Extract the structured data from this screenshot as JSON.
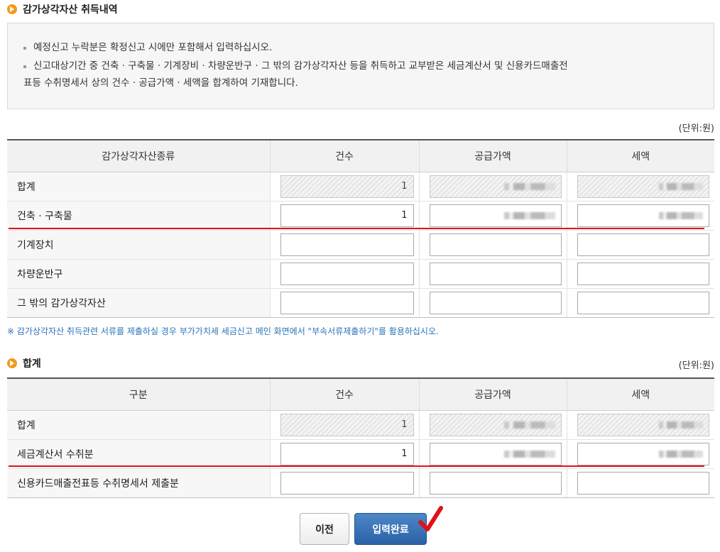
{
  "section1": {
    "title": "감가상각자산 취득내역",
    "notices": [
      "예정신고 누락분은 확정신고 시에만 포함해서 입력하십시오.",
      "신고대상기간 중 건축 · 구축물 · 기계장비 · 차량운반구 · 그 밖의 감가상각자산 등을 취득하고 교부받은 세금계산서 및 신용카드매출전",
      "표등 수취명세서 상의 건수 · 공급가액 · 세액을 합계하여 기재합니다."
    ],
    "unit": "(단위:원)",
    "headers": [
      "감가상각자산종류",
      "건수",
      "공급가액",
      "세액"
    ],
    "rows": [
      {
        "label": "합계",
        "count": "1",
        "readonly": true,
        "masked": true
      },
      {
        "label": "건축 · 구축물",
        "count": "1",
        "readonly": false,
        "masked": true
      },
      {
        "label": "기계장치",
        "count": "",
        "readonly": false,
        "masked": false
      },
      {
        "label": "차량운반구",
        "count": "",
        "readonly": false,
        "masked": false
      },
      {
        "label": "그 밖의 감가상각자산",
        "count": "",
        "readonly": false,
        "masked": false
      }
    ],
    "footnote": "※ 감가상각자산 취득관련 서류를 제출하실 경우 부가가치세 세금신고 메인 화면에서 \"부속서류제출하기\"를 활용하십시오."
  },
  "section2": {
    "title": "합계",
    "unit": "(단위:원)",
    "headers": [
      "구분",
      "건수",
      "공급가액",
      "세액"
    ],
    "rows": [
      {
        "label": "합계",
        "count": "1",
        "readonly": true,
        "masked": true
      },
      {
        "label": "세금계산서 수취분",
        "count": "1",
        "readonly": false,
        "masked": true
      },
      {
        "label": "신용카드매출전표등 수취명세서 제출분",
        "count": "",
        "readonly": false,
        "masked": false
      }
    ]
  },
  "buttons": {
    "prev": "이전",
    "submit": "입력완료"
  },
  "colors": {
    "accent_orange": "#f29a1c",
    "submit_blue": "#2b61a6",
    "highlight_red": "#d9141b",
    "footnote_blue": "#2a73b8"
  }
}
